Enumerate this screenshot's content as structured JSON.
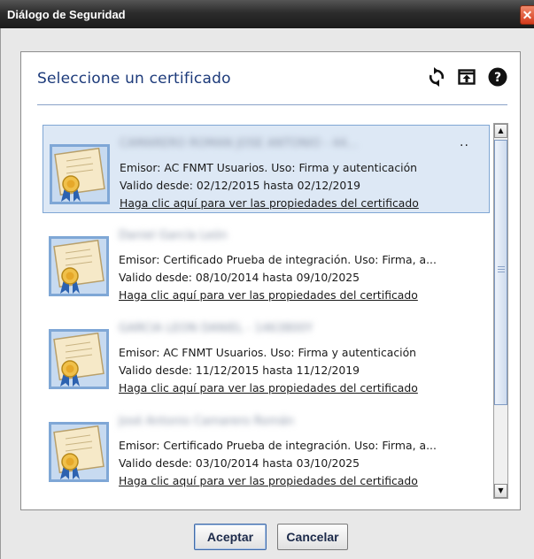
{
  "window": {
    "title": "Diálogo de Seguridad",
    "close_glyph": "✕"
  },
  "panel": {
    "title": "Seleccione un certificado",
    "icons": [
      "refresh-icon",
      "open-file-icon",
      "help-icon"
    ]
  },
  "certificates": [
    {
      "name": "CAMARERO ROMAN JOSE ANTONIO - 44...",
      "issuer_line": "Emisor: AC FNMT Usuarios. Uso: Firma y autenticación",
      "validity_line": "Valido desde: 02/12/2015 hasta 02/12/2019",
      "link_text": "Haga clic aquí para ver las propiedades del certificado",
      "selected": true,
      "truncated_name": true
    },
    {
      "name": "Daniel García León",
      "issuer_line": "Emisor: Certificado Prueba de integración. Uso: Firma, a...",
      "validity_line": "Valido desde: 08/10/2014 hasta 09/10/2025",
      "link_text": "Haga clic aquí para ver las propiedades del certificado",
      "selected": false,
      "truncated_name": false
    },
    {
      "name": "GARCIA LEON DANIEL - 1463800Y",
      "issuer_line": "Emisor: AC FNMT Usuarios. Uso: Firma y autenticación",
      "validity_line": "Valido desde: 11/12/2015 hasta 11/12/2019",
      "link_text": "Haga clic aquí para ver las propiedades del certificado",
      "selected": false,
      "truncated_name": false
    },
    {
      "name": "José Antonio Camarero Román",
      "issuer_line": "Emisor: Certificado Prueba de integración. Uso: Firma, a...",
      "validity_line": "Valido desde: 03/10/2014 hasta 03/10/2025",
      "link_text": "Haga clic aquí para ver las propiedades del certificado",
      "selected": false,
      "truncated_name": false
    }
  ],
  "ellipsis": "..",
  "scrollbar": {
    "up_glyph": "▲",
    "down_glyph": "▼"
  },
  "buttons": {
    "accept": "Aceptar",
    "cancel": "Cancelar"
  },
  "colors": {
    "title_text": "#1c3a7a",
    "selection_bg": "#dde8f5",
    "selection_border": "#7fa6d4",
    "close_button": "#d43a1c"
  }
}
